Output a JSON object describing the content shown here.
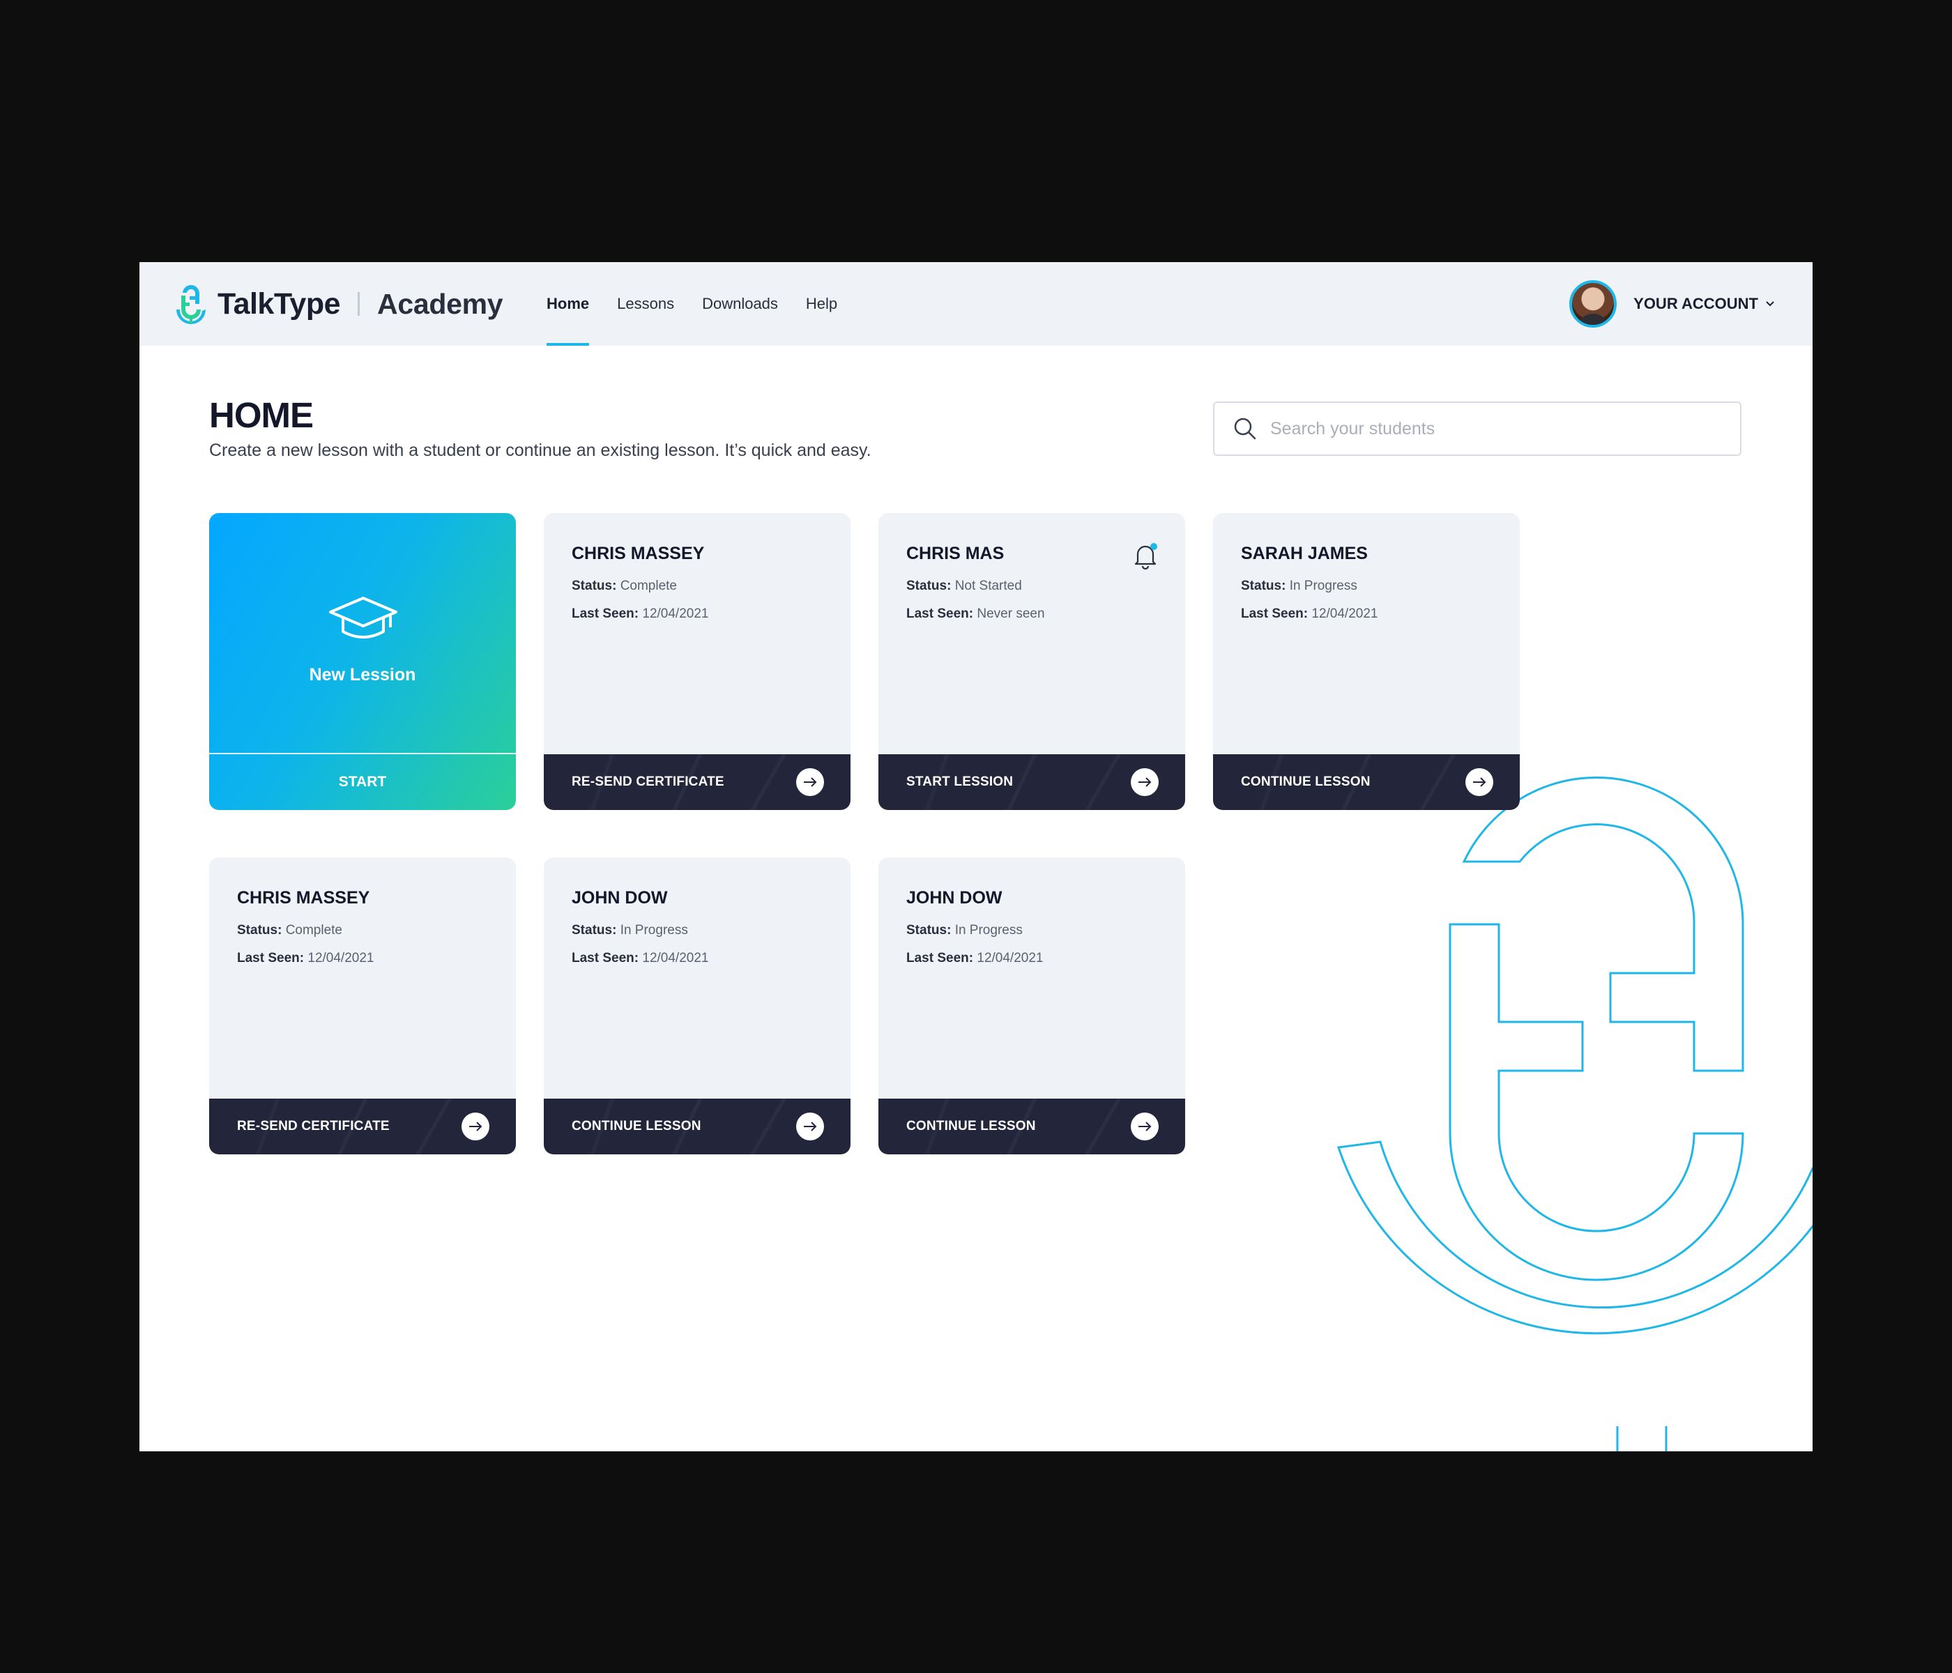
{
  "brand": {
    "name": "TalkType",
    "product": "Academy",
    "accent": "#1fb6e8"
  },
  "nav": [
    {
      "label": "Home",
      "active": true
    },
    {
      "label": "Lessons",
      "active": false
    },
    {
      "label": "Downloads",
      "active": false
    },
    {
      "label": "Help",
      "active": false
    }
  ],
  "account": {
    "label": "YOUR ACCOUNT",
    "icon": "chevron-down-icon"
  },
  "page": {
    "title": "HOME",
    "subtitle": "Create a new lesson with a student or continue an existing lesson. It’s quick and easy."
  },
  "search": {
    "placeholder": "Search your students",
    "value": ""
  },
  "new_lesson": {
    "label": "New Lession",
    "action": "START",
    "icon": "graduation-cap-icon"
  },
  "labels": {
    "status": "Status:",
    "last_seen": "Last Seen:"
  },
  "students": [
    {
      "name": "CHRIS MASSEY",
      "status": "Complete",
      "last_seen": "12/04/2021",
      "action": "RE-SEND CERTIFICATE",
      "notification": false
    },
    {
      "name": "CHRIS MAS",
      "status": "Not Started",
      "last_seen": "Never seen",
      "action": "START LESSION",
      "notification": true
    },
    {
      "name": "SARAH JAMES",
      "status": "In Progress",
      "last_seen": "12/04/2021",
      "action": "CONTINUE LESSON",
      "notification": false
    },
    {
      "name": "CHRIS MASSEY",
      "status": "Complete",
      "last_seen": "12/04/2021",
      "action": "RE-SEND CERTIFICATE",
      "notification": false
    },
    {
      "name": "JOHN DOW",
      "status": "In Progress",
      "last_seen": "12/04/2021",
      "action": "CONTINUE LESSON",
      "notification": false
    },
    {
      "name": "JOHN DOW",
      "status": "In Progress",
      "last_seen": "12/04/2021",
      "action": "CONTINUE LESSON",
      "notification": false
    }
  ]
}
